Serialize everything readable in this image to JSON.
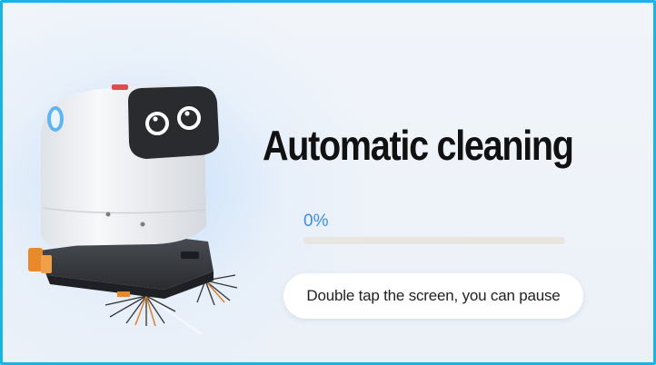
{
  "screen": {
    "title": "Automatic cleaning",
    "progress_label": "0%",
    "progress_value": 0,
    "pause_hint": "Double tap the screen, you can pause",
    "robot_image": "cleaning-robot-illustration"
  },
  "colors": {
    "frame_border": "#1ab3e6",
    "accent_blue": "#3f8be6",
    "track": "#e8e6df",
    "background": "#eef3f9"
  }
}
